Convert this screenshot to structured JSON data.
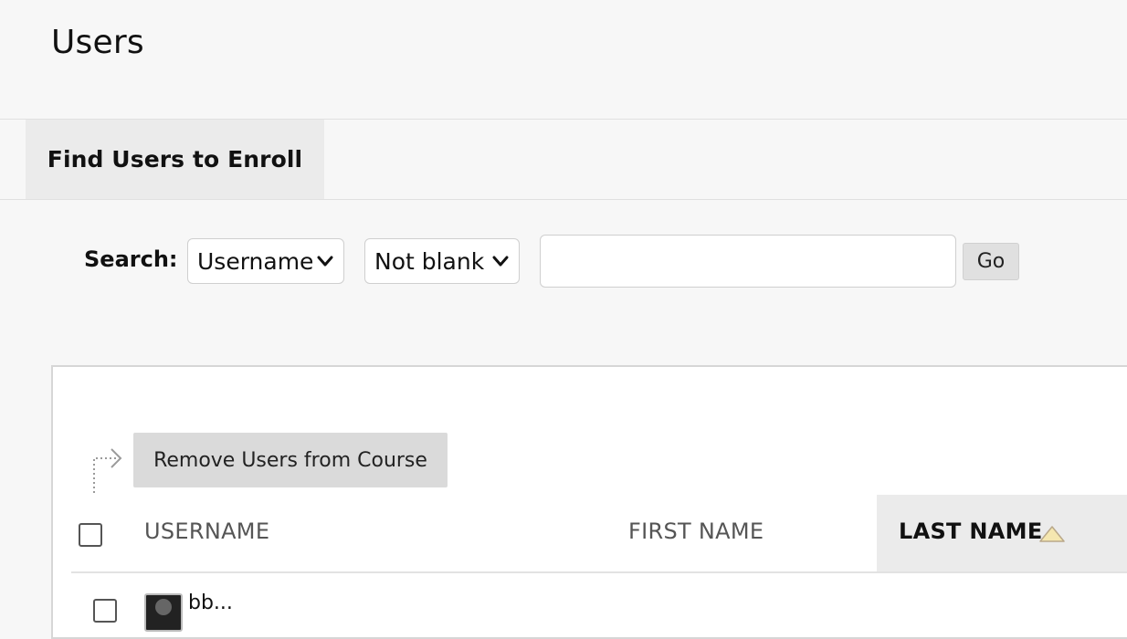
{
  "page": {
    "title": "Users"
  },
  "action_bar": {
    "find_users_label": "Find Users to Enroll"
  },
  "search": {
    "label": "Search:",
    "field_selected": "Username",
    "operator_selected": "Not blank",
    "input_value": "",
    "input_placeholder": "",
    "go_label": "Go"
  },
  "bulk_actions": {
    "remove_label": "Remove Users from Course"
  },
  "table": {
    "columns": [
      {
        "label": "USERNAME",
        "sorted": false
      },
      {
        "label": "FIRST NAME",
        "sorted": false
      },
      {
        "label": "LAST NAME",
        "sorted": true,
        "sort_direction": "ascending"
      }
    ],
    "rows_partial": [
      {
        "username": "bb..."
      }
    ]
  },
  "colors": {
    "background": "#f7f7f7",
    "panel": "#ffffff",
    "button_gray": "#dadada",
    "sorted_header_bg": "#ebebeb",
    "sort_arrow": "#f5e7b0"
  },
  "icons": {
    "select_chevron": "chevron-down-icon",
    "bulk_arrow": "bulk-action-arrow-icon",
    "sort": "sort-ascending-icon",
    "avatar": "user-avatar-icon"
  }
}
